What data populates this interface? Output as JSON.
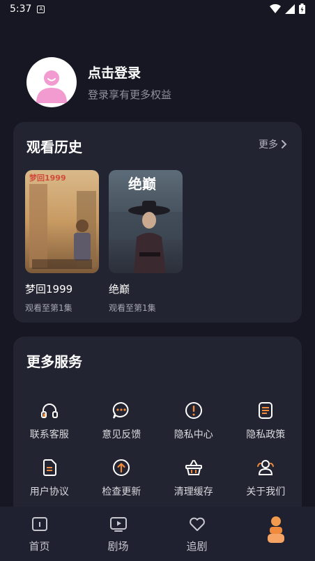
{
  "status_bar": {
    "time": "5:37",
    "notif_glyph": "A"
  },
  "profile": {
    "title": "点击登录",
    "subtitle": "登录享有更多权益"
  },
  "history": {
    "title": "观看历史",
    "more_label": "更多",
    "items": [
      {
        "title": "梦回1999",
        "progress": "观看至第1集",
        "poster_text": "梦回1999"
      },
      {
        "title": "绝巅",
        "progress": "观看至第1集",
        "poster_text": "绝巅"
      }
    ]
  },
  "services": {
    "title": "更多服务",
    "items": [
      {
        "label": "联系客服",
        "icon": "headset-icon"
      },
      {
        "label": "意见反馈",
        "icon": "feedback-icon"
      },
      {
        "label": "隐私中心",
        "icon": "alert-icon"
      },
      {
        "label": "隐私政策",
        "icon": "document-icon"
      },
      {
        "label": "用户协议",
        "icon": "agreement-icon"
      },
      {
        "label": "检查更新",
        "icon": "update-icon"
      },
      {
        "label": "清理缓存",
        "icon": "basket-icon"
      },
      {
        "label": "关于我们",
        "icon": "users-icon"
      }
    ]
  },
  "tabbar": {
    "items": [
      {
        "label": "首页",
        "icon": "home-icon"
      },
      {
        "label": "剧场",
        "icon": "theater-icon"
      },
      {
        "label": "追剧",
        "icon": "heart-icon"
      },
      {
        "label": "",
        "icon": "profile-icon"
      }
    ]
  },
  "colors": {
    "accent": "#f08a3c",
    "background": "#161722",
    "card": "#232431",
    "avatar_pink": "#f29bd0"
  }
}
